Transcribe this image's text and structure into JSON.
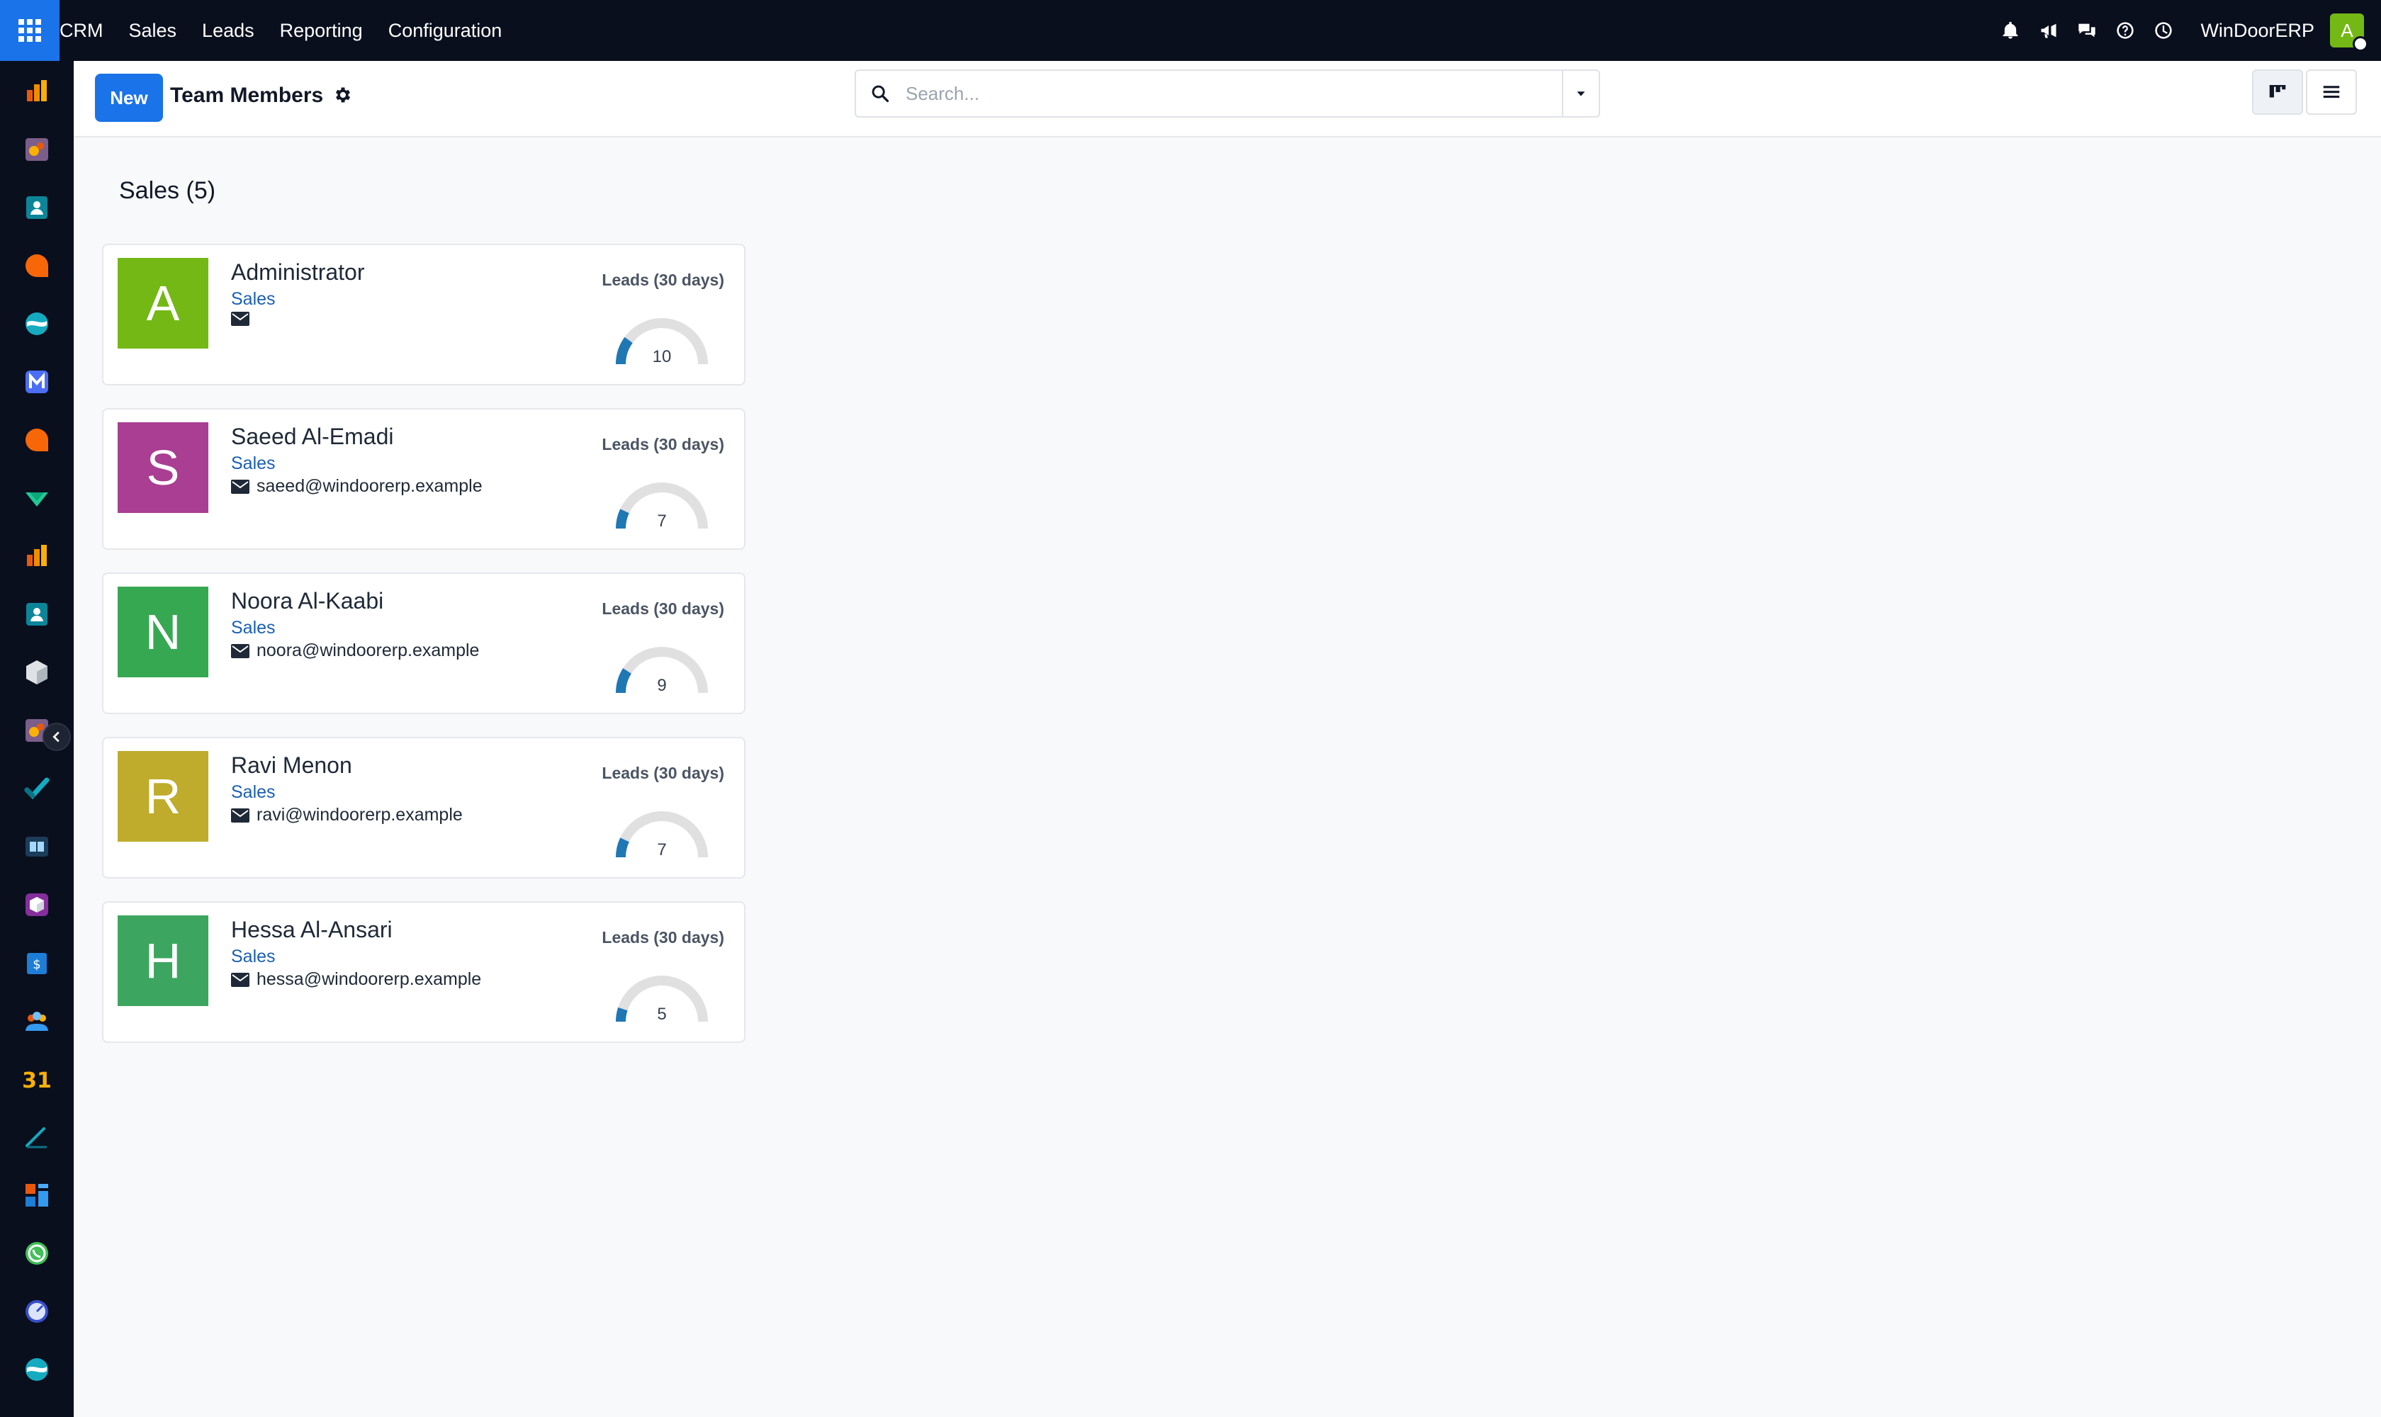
{
  "topbar": {
    "menu": [
      "CRM",
      "Sales",
      "Leads",
      "Reporting",
      "Configuration"
    ],
    "company": "WinDoorERP",
    "user_initial": "A",
    "icons": [
      "bell-icon",
      "megaphone-icon",
      "chat-icon",
      "help-icon",
      "clock-icon"
    ]
  },
  "sidebar": {
    "apps": [
      "dashboards-icon",
      "sales-icon",
      "contacts-icon",
      "crm-icon",
      "discuss-icon",
      "email-marketing-icon",
      "live-chat-icon",
      "invoicing-icon",
      "analytics-icon",
      "employees-icon",
      "inventory-icon",
      "point-of-sale-icon",
      "project-icon",
      "knowledge-icon",
      "manufacturing-icon",
      "expenses-icon",
      "teams-icon",
      "calendar-icon",
      "sign-icon",
      "dashboard-builder-icon",
      "whatsapp-icon",
      "timer-icon",
      "website-icon"
    ]
  },
  "control": {
    "new_label": "New",
    "title": "Team Members",
    "search_placeholder": "Search..."
  },
  "column": {
    "title": "Sales (5)"
  },
  "members": [
    {
      "initial": "A",
      "name": "Administrator",
      "team": "Sales",
      "email": "",
      "gauge_label": "Leads (30 days)",
      "leads": 10,
      "color": "#74b816"
    },
    {
      "initial": "S",
      "name": "Saeed Al-Emadi",
      "team": "Sales",
      "email": "saeed@windoorerp.example",
      "gauge_label": "Leads (30 days)",
      "leads": 7,
      "color": "#a93e92"
    },
    {
      "initial": "N",
      "name": "Noora Al-Kaabi",
      "team": "Sales",
      "email": "noora@windoorerp.example",
      "gauge_label": "Leads (30 days)",
      "leads": 9,
      "color": "#37a852"
    },
    {
      "initial": "R",
      "name": "Ravi Menon",
      "team": "Sales",
      "email": "ravi@windoorerp.example",
      "gauge_label": "Leads (30 days)",
      "leads": 7,
      "color": "#bfac2c"
    },
    {
      "initial": "H",
      "name": "Hessa Al-Ansari",
      "team": "Sales",
      "email": "hessa@windoorerp.example",
      "gauge_label": "Leads (30 days)",
      "leads": 5,
      "color": "#3ca660"
    }
  ],
  "colors": {
    "accent": "#1a73e8",
    "link": "#1a5fb4",
    "gauge_fill": "#1f77b4",
    "gauge_track": "#e0e0e0"
  }
}
